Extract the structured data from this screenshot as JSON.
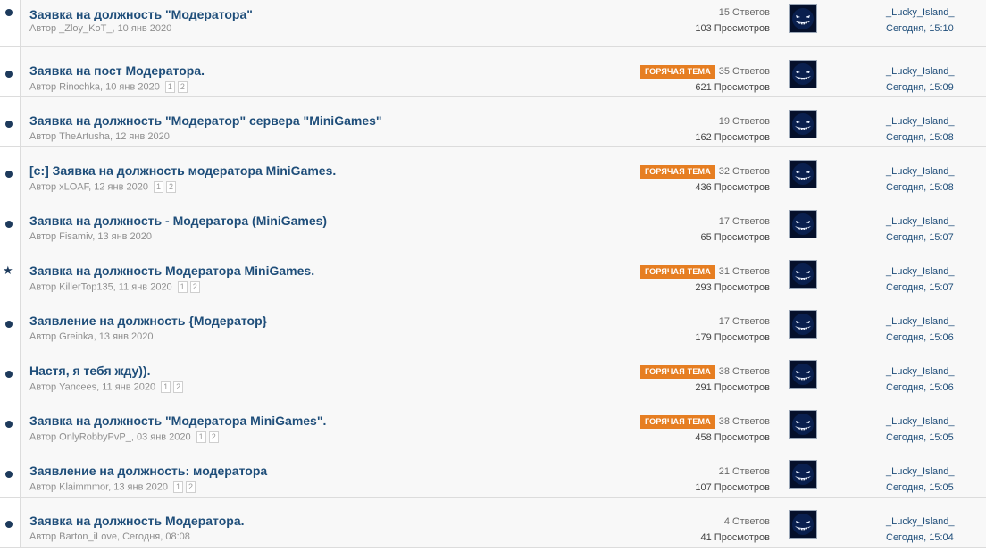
{
  "threads": [
    {
      "title": "Заявка на должность \"Модератора\"",
      "meta": "Автор _Zloy_KoT_, 10 янв 2020",
      "pages": [],
      "hot": "",
      "replies": "15 Ответов",
      "views": "103 Просмотров",
      "last_user": "_Lucky_Island_",
      "last_time": "Сегодня, 15:10",
      "icon": "dot-icon"
    },
    {
      "title": "Заявка на пост Модератора.",
      "meta": "Автор Rinochka, 10 янв 2020",
      "pages": [
        "1",
        "2"
      ],
      "hot": "ГОРЯЧАЯ ТЕМА",
      "replies": "35 Ответов",
      "views": "621 Просмотров",
      "last_user": "_Lucky_Island_",
      "last_time": "Сегодня, 15:09",
      "icon": "dot-icon"
    },
    {
      "title": "Заявка на должность \"Модератор\" сервера \"MiniGames\"",
      "meta": "Автор TheArtusha, 12 янв 2020",
      "pages": [],
      "hot": "",
      "replies": "19 Ответов",
      "views": "162 Просмотров",
      "last_user": "_Lucky_Island_",
      "last_time": "Сегодня, 15:08",
      "icon": "dot-icon"
    },
    {
      "title": "[c:] Заявка на должность модератора MiniGames.",
      "meta": "Автор xLOAF, 12 янв 2020",
      "pages": [
        "1",
        "2"
      ],
      "hot": "ГОРЯЧАЯ ТЕМА",
      "replies": "32 Ответов",
      "views": "436 Просмотров",
      "last_user": "_Lucky_Island_",
      "last_time": "Сегодня, 15:08",
      "icon": "dot-icon"
    },
    {
      "title": "Заявка на должность - Модератора (MiniGames)",
      "meta": "Автор Fisamiv, 13 янв 2020",
      "pages": [],
      "hot": "",
      "replies": "17 Ответов",
      "views": "65 Просмотров",
      "last_user": "_Lucky_Island_",
      "last_time": "Сегодня, 15:07",
      "icon": "dot-icon"
    },
    {
      "title": "Заявка на должность Модератора MiniGames.",
      "meta": "Автор KillerTop135, 11 янв 2020",
      "pages": [
        "1",
        "2"
      ],
      "hot": "ГОРЯЧАЯ ТЕМА",
      "replies": "31 Ответов",
      "views": "293 Просмотров",
      "last_user": "_Lucky_Island_",
      "last_time": "Сегодня, 15:07",
      "icon": "star-icon"
    },
    {
      "title": "Заявление на должность {Модератор}",
      "meta": "Автор Greinka, 13 янв 2020",
      "pages": [],
      "hot": "",
      "replies": "17 Ответов",
      "views": "179 Просмотров",
      "last_user": "_Lucky_Island_",
      "last_time": "Сегодня, 15:06",
      "icon": "dot-icon"
    },
    {
      "title": "Настя, я тебя жду)).",
      "meta": "Автор Yancees, 11 янв 2020",
      "pages": [
        "1",
        "2"
      ],
      "hot": "ГОРЯЧАЯ ТЕМА",
      "replies": "38 Ответов",
      "views": "291 Просмотров",
      "last_user": "_Lucky_Island_",
      "last_time": "Сегодня, 15:06",
      "icon": "dot-icon"
    },
    {
      "title": "Заявка на должность \"Модератора MiniGames\".",
      "meta": "Автор OnlyRobbyPvP_, 03 янв 2020",
      "pages": [
        "1",
        "2"
      ],
      "hot": "ГОРЯЧАЯ ТЕМА",
      "replies": "38 Ответов",
      "views": "458 Просмотров",
      "last_user": "_Lucky_Island_",
      "last_time": "Сегодня, 15:05",
      "icon": "dot-icon"
    },
    {
      "title": "Заявление на должность: модератора",
      "meta": "Автор Klaimmmor, 13 янв 2020",
      "pages": [
        "1",
        "2"
      ],
      "hot": "",
      "replies": "21 Ответов",
      "views": "107 Просмотров",
      "last_user": "_Lucky_Island_",
      "last_time": "Сегодня, 15:05",
      "icon": "dot-icon"
    },
    {
      "title": "Заявка на должность Модератора.",
      "meta": "Автор Barton_iLove, Сегодня, 08:08",
      "pages": [],
      "hot": "",
      "replies": "4 Ответов",
      "views": "41 Просмотров",
      "last_user": "_Lucky_Island_",
      "last_time": "Сегодня, 15:04",
      "icon": "dot-icon"
    }
  ],
  "colors": {
    "accent": "#1f4e7a",
    "hot_badge": "#e67e22",
    "row_bg": "#f8f8f8",
    "avatar_bg": "#06163a"
  }
}
